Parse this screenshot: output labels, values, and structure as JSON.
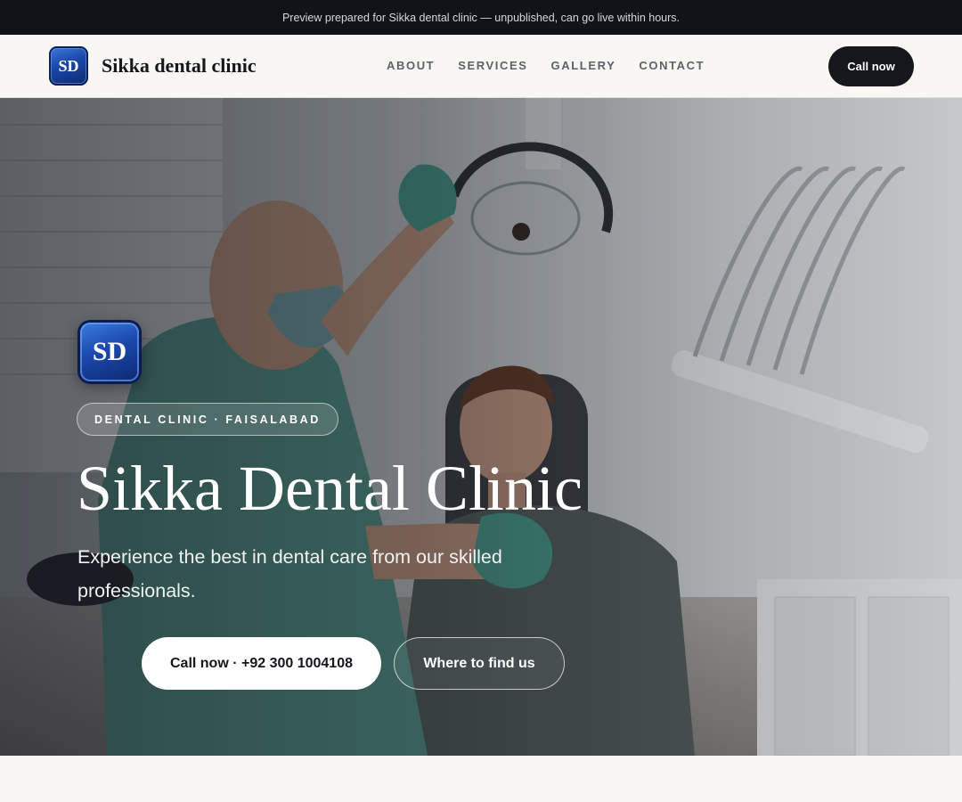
{
  "topbar": {
    "notice": "Preview prepared for Sikka dental clinic — unpublished, can go live within hours."
  },
  "header": {
    "logo_initials": "SD",
    "brand_name": "Sikka dental clinic",
    "nav": [
      {
        "label": "ABOUT"
      },
      {
        "label": "SERVICES"
      },
      {
        "label": "GALLERY"
      },
      {
        "label": "CONTACT"
      }
    ],
    "cta_label": "Call now"
  },
  "hero": {
    "badge_initials": "SD",
    "eyebrow": "DENTAL CLINIC · FAISALABAD",
    "title": "Sikka Dental Clinic",
    "subtitle": "Experience the best in dental care from our skilled professionals.",
    "primary_button": "Call now · +92 300 1004108",
    "secondary_button": "Where to find us",
    "photo_icon": "dentist-treating-patient-photo"
  },
  "colors": {
    "topbar_bg": "#111318",
    "header_bg": "#f8f7f4",
    "dark": "#15171c",
    "logo_blue": "#1a47a8",
    "scrub_teal": "#5fa596"
  }
}
